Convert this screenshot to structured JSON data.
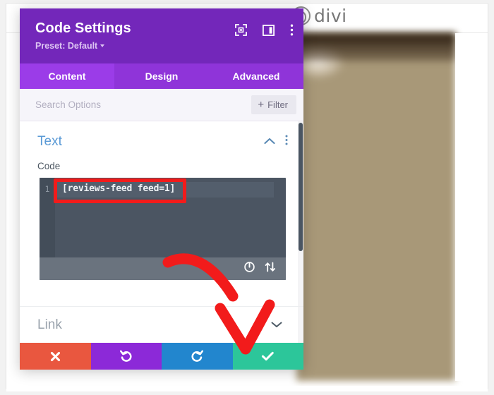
{
  "background": {
    "logo_text": "divi",
    "logo_icon": "divi-circle-logo",
    "photo_alt": "blurred-food-photo"
  },
  "modal": {
    "title": "Code Settings",
    "preset_label": "Preset: Default",
    "header_icons": [
      {
        "name": "focus-target-icon"
      },
      {
        "name": "layout-panel-icon"
      },
      {
        "name": "more-vertical-icon"
      }
    ],
    "tabs": [
      {
        "label": "Content",
        "active": true
      },
      {
        "label": "Design",
        "active": false
      },
      {
        "label": "Advanced",
        "active": false
      }
    ],
    "search": {
      "placeholder": "Search Options",
      "value": "",
      "filter_label": "Filter",
      "filter_plus": "+"
    },
    "sections": {
      "text": {
        "title": "Text",
        "collapse_icon": "chevron-up-icon",
        "menu_icon": "more-vertical-icon",
        "code_field": {
          "label": "Code",
          "line_number": "1",
          "value": "[reviews-feed feed=1]",
          "toolbar_icons": [
            {
              "name": "power-icon"
            },
            {
              "name": "sort-updown-icon"
            }
          ]
        }
      },
      "link": {
        "title": "Link",
        "expand_icon": "chevron-down-icon"
      }
    },
    "footer_actions": [
      {
        "name": "cancel-button",
        "icon": "close-icon",
        "color": "#e9573f",
        "glyph": "✖"
      },
      {
        "name": "undo-button",
        "icon": "undo-icon",
        "color": "#8c29d8",
        "glyph": "↺"
      },
      {
        "name": "redo-button",
        "icon": "redo-icon",
        "color": "#2286ce",
        "glyph": "↻"
      },
      {
        "name": "save-button",
        "icon": "check-icon",
        "color": "#2cc69a",
        "glyph": "✔"
      }
    ]
  },
  "annotations": {
    "highlight_box_target": "code-shortcode-value",
    "arrow_target": "save-button",
    "color": "#f21b1b"
  },
  "colors": {
    "header_purple": "#7327ba",
    "tab_bar_purple": "#8f34d9",
    "tab_active_purple": "#9b3ce8",
    "section_title_blue": "#5a9ad6",
    "code_bg": "#4b5562",
    "annotation_red": "#f21b1b"
  }
}
